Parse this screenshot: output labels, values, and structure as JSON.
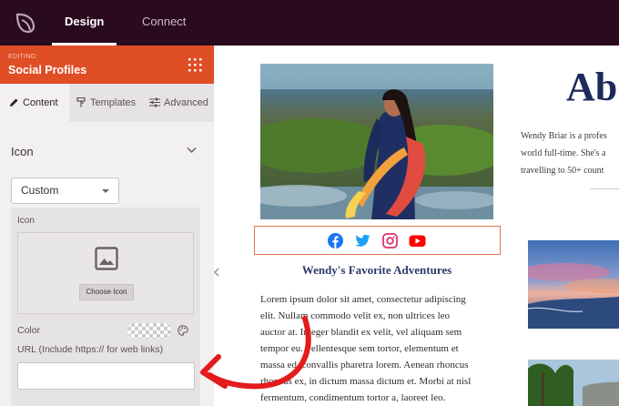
{
  "topbar": {
    "tabs": [
      {
        "label": "Design",
        "active": true
      },
      {
        "label": "Connect",
        "active": false
      }
    ]
  },
  "panel": {
    "editing_label": "EDITING:",
    "title": "Social Profiles",
    "subtabs": [
      {
        "label": "Content",
        "icon": "pencil-icon",
        "active": true
      },
      {
        "label": "Templates",
        "icon": "paint-roller-icon",
        "active": false
      },
      {
        "label": "Advanced",
        "icon": "sliders-icon",
        "active": false
      }
    ],
    "section_title": "Icon",
    "select_value": "Custom",
    "icon_label": "Icon",
    "choose_button": "Choose Icon",
    "color_label": "Color",
    "url_label": "URL (Include https:// for web links)",
    "url_value": ""
  },
  "preview": {
    "social_icons": [
      "facebook-icon",
      "twitter-icon",
      "instagram-icon",
      "youtube-icon"
    ],
    "favorite_title": "Wendy's Favorite Adventures",
    "lorem_lines": [
      "Lorem ipsum dolor sit amet, consectetur adipiscing",
      "elit. Nullam commodo velit ex, non ultrices leo",
      "auctor at. Integer blandit ex velit, vel aliquam sem",
      "tempor eu. Pellentesque sem tortor, elementum et",
      "massa ed, convallis pharetra lorem. Aenean rhoncus",
      "rhoncus ex, in dictum massa dictum et. Morbi at nisl",
      "fermentum, condimentum tortor a, laoreet leo."
    ],
    "about_heading": "Ab",
    "bio_lines": [
      "Wendy Briar is a profes",
      "world full-time. She's a",
      "travelling to 50+ count"
    ]
  },
  "colors": {
    "topbar": "#2a0a1f",
    "panel_header": "#e04e26",
    "accent_arrow": "#e41b1b",
    "social_border": "#e07a50",
    "heading_navy": "#1d2a5a"
  }
}
